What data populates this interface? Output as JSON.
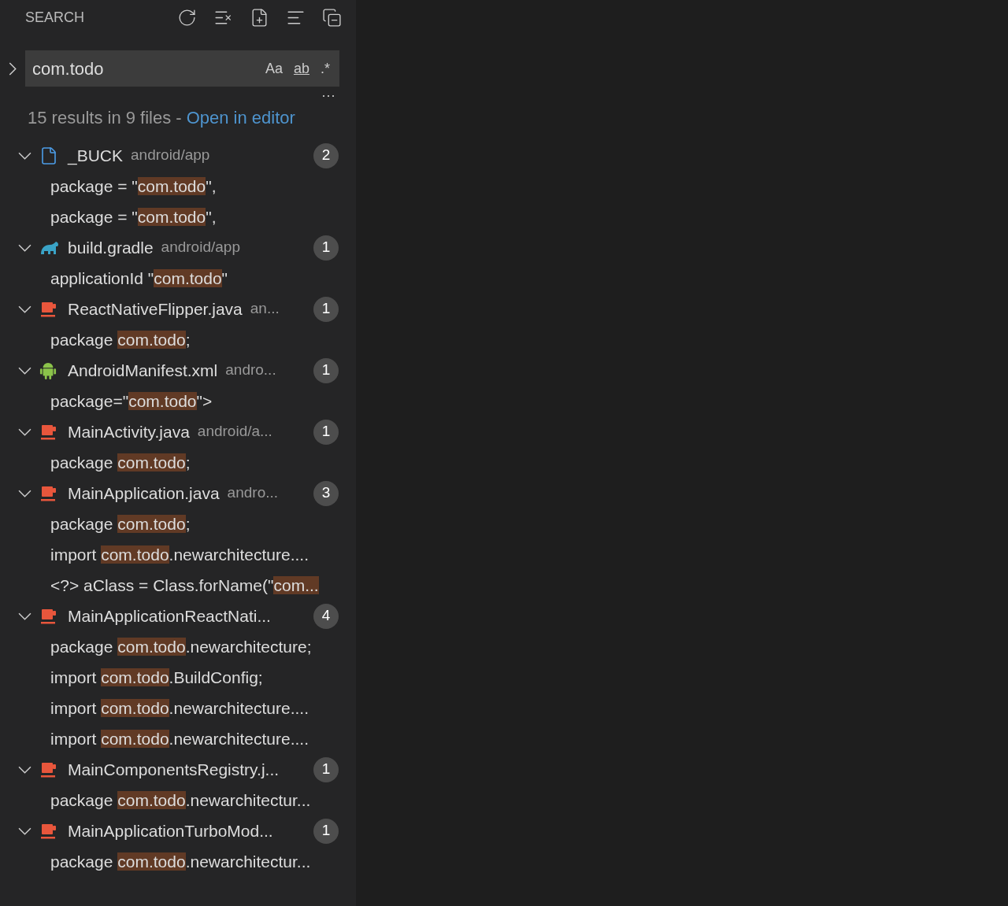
{
  "header": {
    "title": "SEARCH"
  },
  "search": {
    "value": "com.todo",
    "expanded": false,
    "toggles": [
      {
        "label": "Aa",
        "selected": false
      },
      {
        "label": "ab",
        "selected": false
      },
      {
        "label": ".*",
        "selected": false
      }
    ]
  },
  "more": "···",
  "summary": {
    "text": "15 results in 9 files - ",
    "link": "Open in editor"
  },
  "files": [
    {
      "kind": "file",
      "name": "_BUCK",
      "path": "android/app",
      "count": "2",
      "expanded": true,
      "matches": [
        {
          "before": "package = \"",
          "match": "com.todo",
          "after": "\","
        },
        {
          "before": "package = \"",
          "match": "com.todo",
          "after": "\","
        }
      ]
    },
    {
      "kind": "gradle",
      "name": "build.gradle",
      "path": "android/app",
      "count": "1",
      "expanded": true,
      "matches": [
        {
          "before": "applicationId \"",
          "match": "com.todo",
          "after": "\""
        }
      ]
    },
    {
      "kind": "java",
      "name": "ReactNativeFlipper.java",
      "path": "an...",
      "count": "1",
      "expanded": true,
      "matches": [
        {
          "before": "package ",
          "match": "com.todo",
          "after": ";"
        }
      ]
    },
    {
      "kind": "android",
      "name": "AndroidManifest.xml",
      "path": "andro...",
      "count": "1",
      "expanded": true,
      "matches": [
        {
          "before": "package=\"",
          "match": "com.todo",
          "after": "\">"
        }
      ]
    },
    {
      "kind": "java",
      "name": "MainActivity.java",
      "path": "android/a...",
      "count": "1",
      "expanded": true,
      "matches": [
        {
          "before": "package ",
          "match": "com.todo",
          "after": ";"
        }
      ]
    },
    {
      "kind": "java",
      "name": "MainApplication.java",
      "path": "andro...",
      "count": "3",
      "expanded": true,
      "matches": [
        {
          "before": "package ",
          "match": "com.todo",
          "after": ";"
        },
        {
          "before": "import ",
          "match": "com.todo",
          "after": ".newarchitecture...."
        },
        {
          "before": "<?> aClass = Class.forName(\"",
          "match": "com..."
        }
      ]
    },
    {
      "kind": "java",
      "name": "MainApplicationReactNati...",
      "count": "4",
      "expanded": true,
      "matches": [
        {
          "before": "package ",
          "match": "com.todo",
          "after": ".newarchitecture;"
        },
        {
          "before": "import ",
          "match": "com.todo",
          "after": ".BuildConfig;"
        },
        {
          "before": "import ",
          "match": "com.todo",
          "after": ".newarchitecture...."
        },
        {
          "before": "import ",
          "match": "com.todo",
          "after": ".newarchitecture...."
        }
      ]
    },
    {
      "kind": "java",
      "name": "MainComponentsRegistry.j...",
      "count": "1",
      "expanded": true,
      "matches": [
        {
          "before": "package ",
          "match": "com.todo",
          "after": ".newarchitectur..."
        }
      ]
    },
    {
      "kind": "java",
      "name": "MainApplicationTurboMod...",
      "count": "1",
      "expanded": true,
      "matches": [
        {
          "before": "package ",
          "match": "com.todo",
          "after": ".newarchitectur..."
        }
      ]
    }
  ]
}
